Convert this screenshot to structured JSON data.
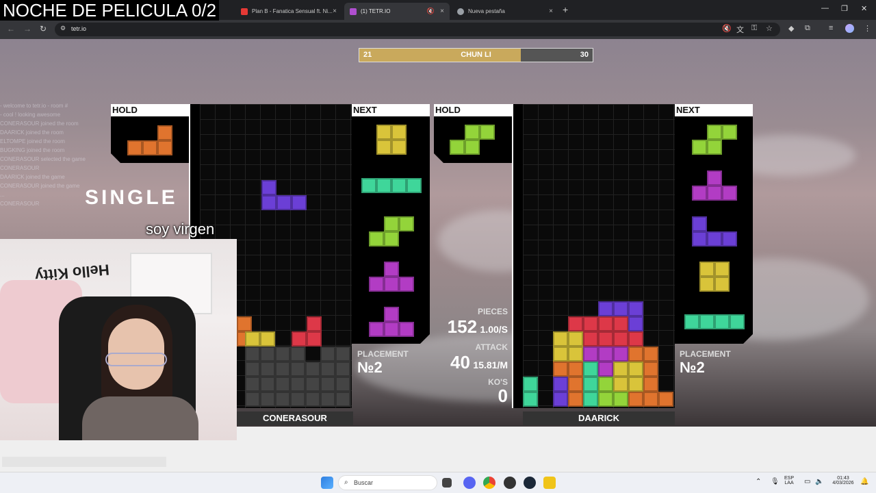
{
  "stream_title": "NOCHE DE PELICULA 0/2",
  "browser": {
    "tabs": [
      {
        "title": "Plan B - Fanatica Sensual ft. Ni...",
        "close": "×",
        "active": false,
        "color": "#e53935"
      },
      {
        "title": "(1) TETR.IO",
        "close": "×",
        "active": true,
        "color": "#b04fd0"
      },
      {
        "title": "Nueva pestaña",
        "close": "×",
        "active": false,
        "color": "#9aa0a6"
      }
    ],
    "new_tab": "+",
    "url": "tetr.io"
  },
  "match": {
    "left_score": "21",
    "opponent_tag": "CHUN LI",
    "right_score": "30",
    "left_progress": 0.691
  },
  "action_text": "SINGLE",
  "caption": "soy virgen",
  "chat_lines": [
    "- welcome to tetr.io - room #",
    "- cool ! looking awesome",
    "CONERASOUR joined the room",
    "DAARICK joined the room",
    "ELTOMPE joined the room",
    "BUGKING joined the room",
    "CONERASOUR selected the game",
    "CONERASOUR",
    "DAARICK joined the game",
    "CONERASOUR joined the game",
    "...",
    "CONERASOUR"
  ],
  "left_player": {
    "hold_label": "HOLD",
    "next_label": "NEXT",
    "placement_label": "PLACEMENT",
    "placement": "№2",
    "name": "CONERASOUR"
  },
  "right_player": {
    "hold_label": "HOLD",
    "next_label": "NEXT",
    "placement_label": "PLACEMENT",
    "placement": "№2",
    "name": "DAARICK",
    "pieces_label": "PIECES",
    "pieces": "152",
    "pps": "1.00/S",
    "attack_label": "ATTACK",
    "attack": "40",
    "apm": "15.81/M",
    "kos_label": "KO'S",
    "kos": "0"
  },
  "colors": {
    "L": "#e0742e",
    "O": "#d9c43a",
    "S": "#93d43a",
    "J": "#6b3fd6",
    "I": "#3fd69a",
    "T": "#b23cc4",
    "Z": "#dd3848",
    "garbage": "#444444",
    "score_fill": "#c9a95c"
  },
  "taskbar": {
    "search_placeholder": "Buscar",
    "lang_top": "ESP",
    "lang_bottom": "LAA",
    "time": "01:43",
    "date": "4/03/2026"
  }
}
